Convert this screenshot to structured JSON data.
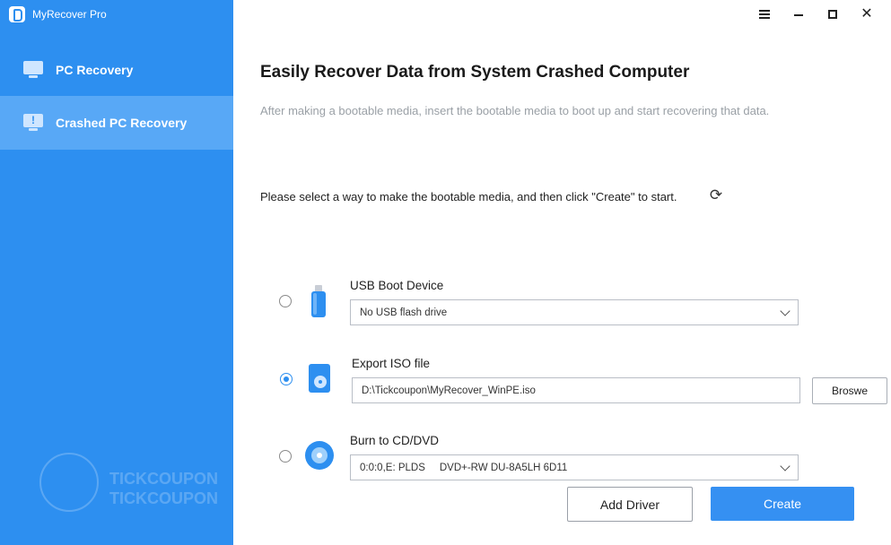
{
  "app": {
    "title": "MyRecover Pro"
  },
  "sidebar": {
    "items": [
      {
        "label": "PC Recovery",
        "icon": "monitor-icon",
        "active": false
      },
      {
        "label": "Crashed PC Recovery",
        "icon": "monitor-alert-icon",
        "active": true
      }
    ]
  },
  "window_controls": {
    "icons": [
      "menu-icon",
      "minimize-icon",
      "maximize-icon",
      "close-icon"
    ]
  },
  "main": {
    "title": "Easily Recover Data from System Crashed Computer",
    "subtitle": "After making a bootable media, insert the bootable media to boot up and start recovering that data.",
    "instruction": "Please select a way to make the bootable media, and then click \"Create\" to start.",
    "options": [
      {
        "label": "USB Boot Device",
        "icon": "usb-drive-icon",
        "control": "select",
        "value": "No USB flash drive",
        "selected": false
      },
      {
        "label": "Export ISO file",
        "icon": "iso-file-icon",
        "control": "text",
        "value": "D:\\Tickcoupon\\MyRecover_WinPE.iso",
        "selected": true
      },
      {
        "label": "Burn to CD/DVD",
        "icon": "cd-dvd-icon",
        "control": "select",
        "value": "0:0:0,E: PLDS     DVD+-RW DU-8A5LH 6D11",
        "selected": false
      }
    ],
    "browse_label": "Broswe",
    "add_driver_label": "Add Driver",
    "create_label": "Create"
  },
  "colors": {
    "sidebar": "#2d8ff0",
    "sidebar_active": "#58a8f6",
    "primary_button": "#3590f2"
  }
}
